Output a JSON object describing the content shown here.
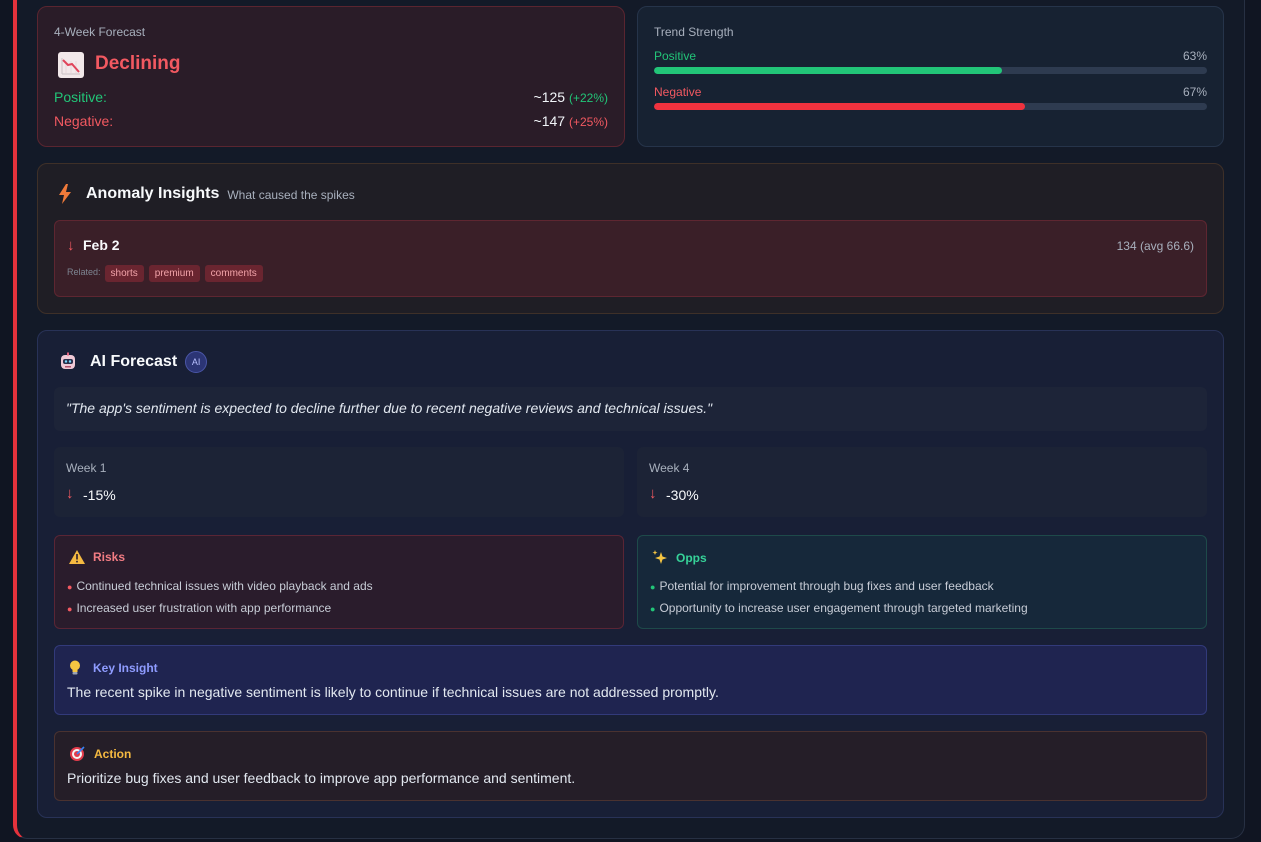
{
  "forecast": {
    "label": "4-Week Forecast",
    "status": "Declining",
    "positive_label": "Positive:",
    "positive_value": "~125",
    "positive_change": "(+22%)",
    "negative_label": "Negative:",
    "negative_value": "~147",
    "negative_change": "(+25%)"
  },
  "trend": {
    "label": "Trend Strength",
    "positive_label": "Positive",
    "positive_pct": "63%",
    "positive_level": 0.63,
    "negative_label": "Negative",
    "negative_pct": "67%",
    "negative_level": 0.67
  },
  "anomaly": {
    "title": "Anomaly Insights",
    "subtitle": "What caused the spikes",
    "item": {
      "arrow": "↓",
      "date": "Feb 2",
      "count": "134 (avg 66.6)",
      "related_label": "Related:",
      "tags": [
        "shorts",
        "premium",
        "comments"
      ]
    }
  },
  "ai": {
    "title": "AI Forecast",
    "badge": "AI",
    "quote": "\"The app's sentiment is expected to decline further due to recent negative reviews and technical issues.\"",
    "week1": {
      "label": "Week 1",
      "arrow": "↓",
      "value": "-15%"
    },
    "week4": {
      "label": "Week 4",
      "arrow": "↓",
      "value": "-30%"
    },
    "risks": {
      "title": "Risks",
      "items": [
        "Continued technical issues with video playback and ads",
        "Increased user frustration with app performance"
      ]
    },
    "opps": {
      "title": "Opps",
      "items": [
        "Potential for improvement through bug fixes and user feedback",
        "Opportunity to increase user engagement through targeted marketing"
      ]
    },
    "insight": {
      "title": "Key Insight",
      "text": "The recent spike in negative sentiment is likely to continue if technical issues are not addressed promptly."
    },
    "action": {
      "title": "Action",
      "text": "Prioritize bug fixes and user feedback to improve app performance and sentiment."
    }
  },
  "colors": {
    "accent_red": "#f25961",
    "accent_green": "#22c578",
    "ai_purple": "#8f9cff",
    "action_amber": "#f5b941"
  },
  "icons": {
    "forecast": "chart-decreasing-icon",
    "anomaly": "lightning-bolt-icon",
    "ai": "robot-icon",
    "risks": "warning-icon",
    "opps": "sparkles-icon",
    "insight": "lightbulb-icon",
    "action": "target-icon"
  }
}
